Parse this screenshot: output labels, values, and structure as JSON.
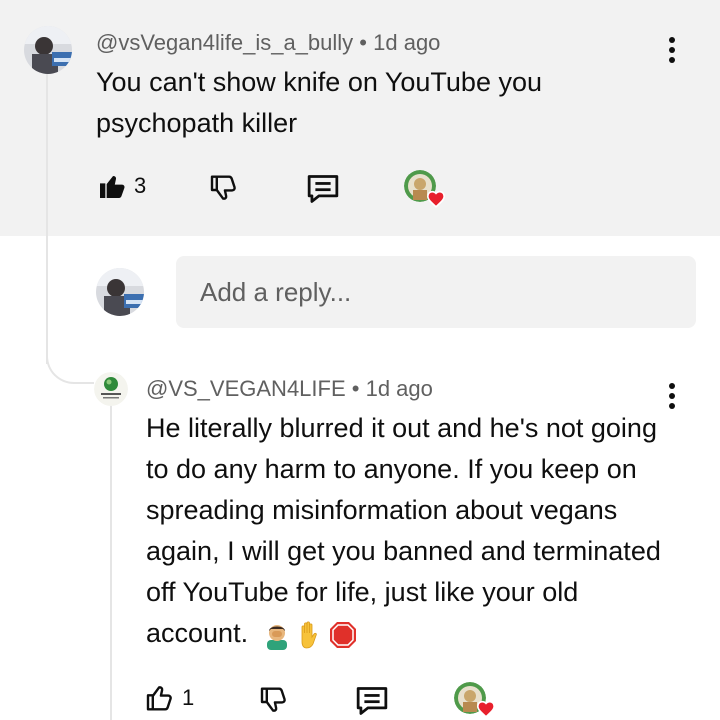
{
  "comment": {
    "handle": "@vsVegan4life_is_a_bully",
    "sep": "•",
    "time": "1d ago",
    "text": "You can't show knife on YouTube you psychopath killer",
    "like_count": "3"
  },
  "reply_box": {
    "placeholder": "Add a reply..."
  },
  "reply": {
    "handle": "@VS_VEGAN4LIFE",
    "sep": "•",
    "time": "1d ago",
    "text": "He literally blurred it out and he's not going to do any harm to anyone. If you keep on spreading misinformation about vegans again, I will get you banned and terminated off YouTube for life, just like your old account.",
    "like_count": "1"
  },
  "colors": {
    "highlight_bg": "#f2f2f2",
    "secondary_text": "#606060",
    "heart": "#e8202c"
  },
  "icons": [
    "like-filled-icon",
    "dislike-icon",
    "reply-icon",
    "creator-heart-icon",
    "more-vert-icon",
    "like-outline-icon"
  ]
}
